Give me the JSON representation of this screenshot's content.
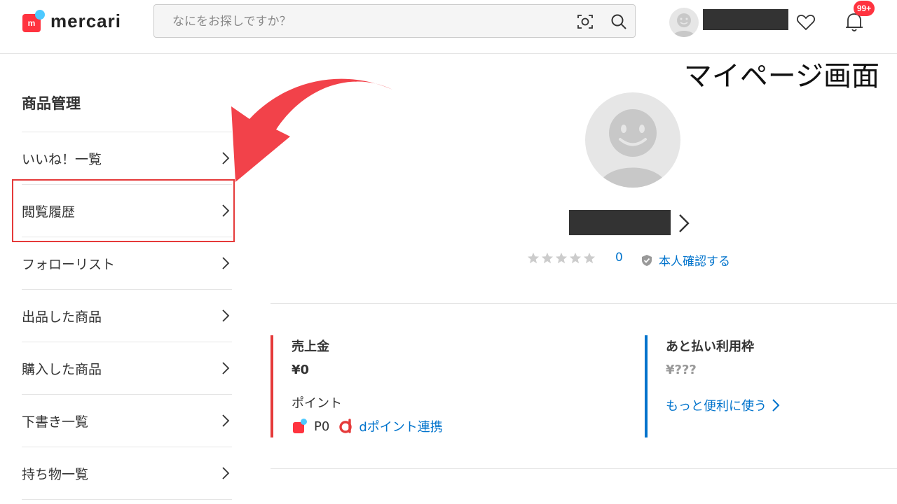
{
  "header": {
    "logo_text": "mercari",
    "logo_mark": "m",
    "search_placeholder": "なにをお探しですか？",
    "notification_badge": "99+"
  },
  "annotation": {
    "title": "マイページ画面"
  },
  "sidebar": {
    "title": "商品管理",
    "items": [
      {
        "label": "いいね！一覧"
      },
      {
        "label": "閲覧履歴"
      },
      {
        "label": "フォローリスト"
      },
      {
        "label": "出品した商品"
      },
      {
        "label": "購入した商品"
      },
      {
        "label": "下書き一覧"
      },
      {
        "label": "持ち物一覧"
      }
    ]
  },
  "profile": {
    "rating_count": "0",
    "rating_stars": 0,
    "verify_label": "本人確認する"
  },
  "sales": {
    "label": "売上金",
    "value": "¥0",
    "points_label": "ポイント",
    "points_value": "P0",
    "dpoint_link": "dポイント連携"
  },
  "paylater": {
    "label": "あと払い利用枠",
    "value": "¥???",
    "more_link": "もっと便利に使う"
  },
  "colors": {
    "brand_red": "#ff333f",
    "brand_blue": "#4dc9ff",
    "link_blue": "#0073cc",
    "highlight_red": "#e53a3a"
  }
}
